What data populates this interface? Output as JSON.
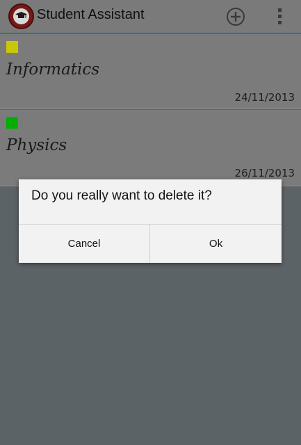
{
  "appbar": {
    "title": "Student Assistant",
    "app_icon": "graduation-cap-icon",
    "add_icon": "add-circle-icon",
    "overflow_icon": "more-vertical-icon"
  },
  "subjects": [
    {
      "name": "Informatics",
      "date": "24/11/2013",
      "color": "#c8c800"
    },
    {
      "name": "Physics",
      "date": "26/11/2013",
      "color": "#00b000"
    }
  ],
  "dialog": {
    "message": "Do you really want to delete it?",
    "cancel_label": "Cancel",
    "ok_label": "Ok"
  },
  "colors": {
    "accent_divider": "#2f6f9a",
    "app_icon_ring": "#7a1818"
  }
}
